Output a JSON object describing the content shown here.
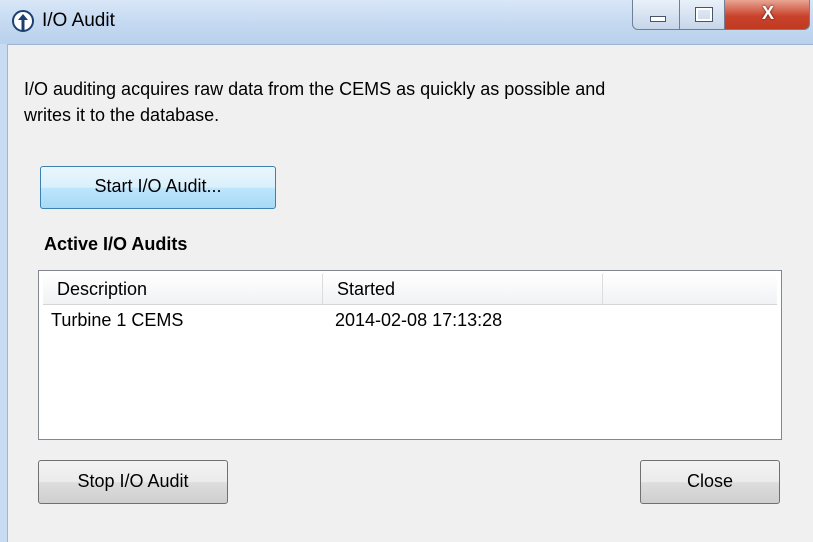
{
  "window": {
    "title": "I/O Audit",
    "close_glyph": "X",
    "icon": "app-info-icon"
  },
  "description": "I/O auditing acquires raw data from the CEMS as quickly as possible and writes it to the database.",
  "buttons": {
    "start": "Start I/O Audit...",
    "stop": "Stop I/O Audit",
    "close": "Close"
  },
  "active_audits": {
    "label": "Active I/O Audits",
    "columns": [
      "Description",
      "Started",
      ""
    ],
    "rows": [
      {
        "description": "Turbine 1 CEMS",
        "started": "2014-02-08 17:13:28"
      }
    ]
  },
  "colors": {
    "titlebar": "#c7dbf2",
    "close_button": "#c9432c",
    "focused_button_border": "#3c7fb1"
  }
}
